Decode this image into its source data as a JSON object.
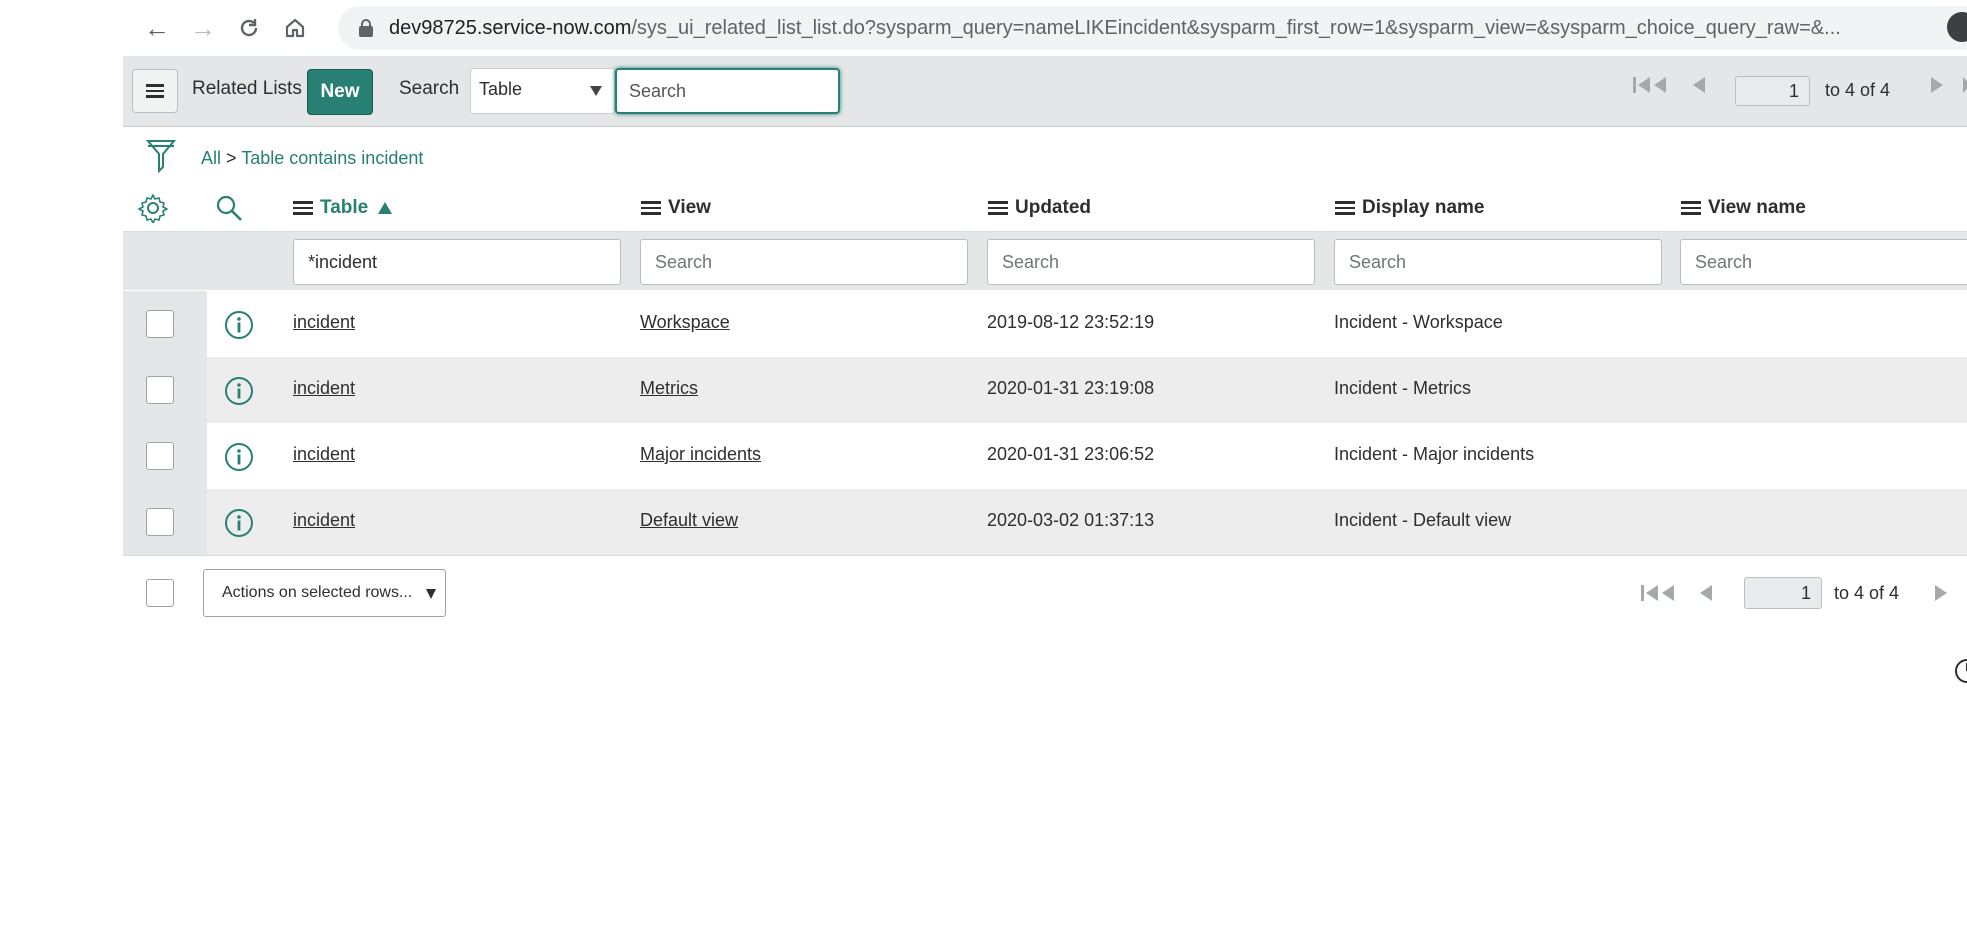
{
  "browser": {
    "url_host": "dev98725.service-now.com",
    "url_path": "/sys_ui_related_list_list.do?sysparm_query=nameLIKEincident&sysparm_first_row=1&sysparm_view=&sysparm_choice_query_raw=&..."
  },
  "header": {
    "title": "Related Lists",
    "new_label": "New",
    "search_label": "Search",
    "search_field": "Table",
    "search_placeholder": "Search",
    "pager": {
      "page": "1",
      "range_text": "to 4 of 4"
    }
  },
  "breadcrumb": {
    "all": "All",
    "separator": ">",
    "condition": "Table contains incident"
  },
  "columns": [
    {
      "label": "Table",
      "sorted": "asc"
    },
    {
      "label": "View"
    },
    {
      "label": "Updated"
    },
    {
      "label": "Display name"
    },
    {
      "label": "View name"
    }
  ],
  "filters": {
    "table": "*incident",
    "view_placeholder": "Search",
    "updated_placeholder": "Search",
    "display_name_placeholder": "Search",
    "view_name_placeholder": "Search"
  },
  "rows": [
    {
      "table": "incident",
      "view": "Workspace",
      "updated": "2019-08-12 23:52:19",
      "display_name": "Incident - Workspace",
      "view_name": ""
    },
    {
      "table": "incident",
      "view": "Metrics",
      "updated": "2020-01-31 23:19:08",
      "display_name": "Incident - Metrics",
      "view_name": ""
    },
    {
      "table": "incident",
      "view": "Major incidents",
      "updated": "2020-01-31 23:06:52",
      "display_name": "Incident - Major incidents",
      "view_name": ""
    },
    {
      "table": "incident",
      "view": "Default view",
      "updated": "2020-03-02 01:37:13",
      "display_name": "Incident - Default view",
      "view_name": ""
    }
  ],
  "footer": {
    "actions_label": "Actions on selected rows...",
    "pager": {
      "page": "1",
      "range_text": "to 4 of 4"
    }
  },
  "colors": {
    "accent": "#278073",
    "header_bg": "#e4e6e7",
    "stripe": "#ededed"
  }
}
